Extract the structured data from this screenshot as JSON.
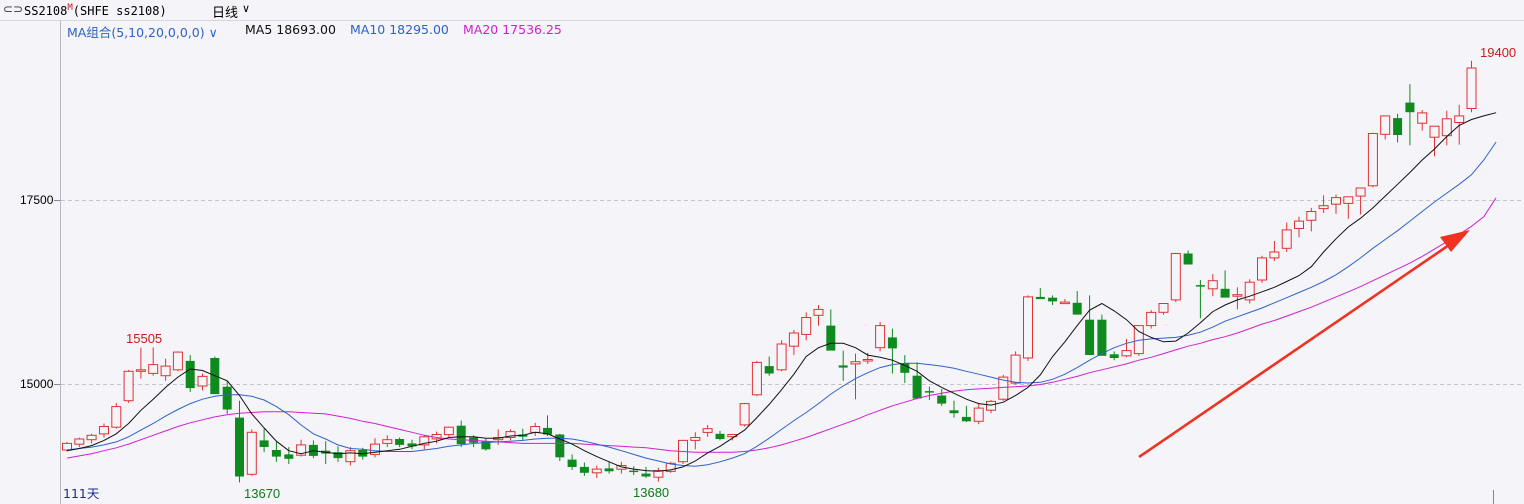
{
  "header": {
    "symbol_icon": "symbol-switch-icon",
    "symbol_code": "SS2108",
    "symbol_sup": "M",
    "exchange": "(SHFE ss2108)",
    "period": "日线",
    "period_chevron": "chevron-down-icon"
  },
  "indicator": {
    "name": "MA组合(5,10,20,0,0,0)",
    "ma5_label": "MA5 18693.00",
    "ma10_label": "MA10 18295.00",
    "ma20_label": "MA20 17536.25",
    "colors": {
      "ma5": "#111111",
      "ma10": "#2e62c9",
      "ma20": "#d020d0",
      "up": "#e03232",
      "down": "#0f8a1f",
      "arrow": "#ee3322"
    }
  },
  "footer": {
    "day_count": "111天"
  },
  "chart_data": {
    "type": "candlestick",
    "title": "",
    "y_ticks": [
      15000,
      17500
    ],
    "ylim": [
      13550,
      19700
    ],
    "grid": "dashed horizontal at y ticks",
    "annotations": {
      "high_1": "15505",
      "low_1": "13670",
      "low_2": "13680",
      "high_2": "19400"
    },
    "trend_arrow": "red arrow pointing up-right",
    "ohlc": [
      [
        14110,
        14220,
        14090,
        14200
      ],
      [
        14190,
        14280,
        14150,
        14260
      ],
      [
        14250,
        14330,
        14200,
        14310
      ],
      [
        14330,
        14470,
        14280,
        14430
      ],
      [
        14420,
        14750,
        14400,
        14700
      ],
      [
        14780,
        15200,
        14750,
        15180
      ],
      [
        15200,
        15500,
        15080,
        15200
      ],
      [
        15150,
        15505,
        15120,
        15270
      ],
      [
        15120,
        15350,
        15050,
        15250
      ],
      [
        15200,
        15450,
        15180,
        15440
      ],
      [
        15320,
        15400,
        14900,
        14950
      ],
      [
        14980,
        15150,
        14920,
        15110
      ],
      [
        15360,
        15380,
        14880,
        14870
      ],
      [
        14970,
        15050,
        14600,
        14660
      ],
      [
        14550,
        14780,
        13670,
        13750
      ],
      [
        13780,
        14390,
        13760,
        14350
      ],
      [
        14240,
        14400,
        14080,
        14150
      ],
      [
        14110,
        14220,
        13950,
        14020
      ],
      [
        14050,
        14150,
        13920,
        13990
      ],
      [
        14040,
        14250,
        14020,
        14180
      ],
      [
        14180,
        14240,
        14000,
        14030
      ],
      [
        14100,
        14230,
        13920,
        14060
      ],
      [
        14080,
        14160,
        13950,
        14000
      ],
      [
        13950,
        14150,
        13900,
        14100
      ],
      [
        14110,
        14140,
        13980,
        14020
      ],
      [
        14050,
        14270,
        14010,
        14190
      ],
      [
        14200,
        14310,
        14150,
        14250
      ],
      [
        14260,
        14280,
        14150,
        14180
      ],
      [
        14200,
        14250,
        14120,
        14160
      ],
      [
        14180,
        14310,
        14120,
        14290
      ],
      [
        14260,
        14360,
        14200,
        14320
      ],
      [
        14320,
        14430,
        14290,
        14420
      ],
      [
        14440,
        14510,
        14150,
        14190
      ],
      [
        14280,
        14310,
        14150,
        14210
      ],
      [
        14230,
        14260,
        14100,
        14120
      ],
      [
        14250,
        14390,
        14180,
        14280
      ],
      [
        14280,
        14390,
        14240,
        14360
      ],
      [
        14320,
        14400,
        14240,
        14290
      ],
      [
        14350,
        14480,
        14300,
        14430
      ],
      [
        14410,
        14580,
        14300,
        14320
      ],
      [
        14320,
        14330,
        13960,
        14010
      ],
      [
        13980,
        14050,
        13840,
        13880
      ],
      [
        13880,
        13940,
        13760,
        13800
      ],
      [
        13800,
        13900,
        13730,
        13850
      ],
      [
        13860,
        13950,
        13790,
        13820
      ],
      [
        13850,
        13950,
        13790,
        13900
      ],
      [
        13830,
        13890,
        13770,
        13810
      ],
      [
        13790,
        13880,
        13730,
        13750
      ],
      [
        13740,
        13870,
        13680,
        13830
      ],
      [
        13820,
        13950,
        13800,
        13930
      ],
      [
        13950,
        14250,
        13920,
        14240
      ],
      [
        14240,
        14350,
        14120,
        14280
      ],
      [
        14350,
        14450,
        14290,
        14400
      ],
      [
        14330,
        14370,
        14240,
        14260
      ],
      [
        14290,
        14330,
        14240,
        14320
      ],
      [
        14450,
        14750,
        14430,
        14740
      ],
      [
        14860,
        15320,
        14840,
        15300
      ],
      [
        15250,
        15380,
        15120,
        15150
      ],
      [
        15200,
        15600,
        15180,
        15550
      ],
      [
        15520,
        15740,
        15400,
        15700
      ],
      [
        15680,
        15980,
        15600,
        15910
      ],
      [
        15940,
        16080,
        15800,
        16020
      ],
      [
        15800,
        16020,
        15500,
        15460
      ],
      [
        15260,
        15460,
        15050,
        15230
      ],
      [
        15280,
        15420,
        14800,
        15310
      ],
      [
        15320,
        15430,
        15280,
        15340
      ],
      [
        15500,
        15850,
        15450,
        15800
      ],
      [
        15640,
        15760,
        15150,
        15490
      ],
      [
        15290,
        15400,
        15020,
        15160
      ],
      [
        15120,
        15300,
        14800,
        14810
      ],
      [
        14910,
        14970,
        14790,
        14890
      ],
      [
        14850,
        14940,
        14710,
        14740
      ],
      [
        14650,
        14780,
        14550,
        14610
      ],
      [
        14560,
        14710,
        14490,
        14500
      ],
      [
        14500,
        14750,
        14460,
        14680
      ],
      [
        14650,
        14790,
        14610,
        14770
      ],
      [
        14800,
        15130,
        14780,
        15100
      ],
      [
        15020,
        15450,
        15000,
        15400
      ],
      [
        15360,
        16210,
        15320,
        16190
      ],
      [
        16190,
        16310,
        16170,
        16160
      ],
      [
        16180,
        16210,
        16080,
        16130
      ],
      [
        16110,
        16160,
        16100,
        16120
      ],
      [
        16110,
        16270,
        15950,
        15950
      ],
      [
        15880,
        16210,
        15420,
        15400
      ],
      [
        15880,
        15950,
        15550,
        15390
      ],
      [
        15410,
        15450,
        15330,
        15360
      ],
      [
        15390,
        15620,
        15370,
        15460
      ],
      [
        15420,
        15700,
        15390,
        15800
      ],
      [
        15800,
        16010,
        15760,
        15980
      ],
      [
        15980,
        16040,
        15950,
        16100
      ],
      [
        16150,
        16790,
        16120,
        16780
      ],
      [
        16780,
        16820,
        16760,
        16630
      ],
      [
        16350,
        16420,
        15900,
        16330
      ],
      [
        16300,
        16500,
        16200,
        16410
      ],
      [
        16300,
        16550,
        16250,
        16180
      ],
      [
        16200,
        16320,
        16020,
        16220
      ],
      [
        16150,
        16430,
        16100,
        16390
      ],
      [
        16420,
        16750,
        16380,
        16720
      ],
      [
        16720,
        16950,
        16680,
        16800
      ],
      [
        16850,
        17200,
        16800,
        17100
      ],
      [
        17120,
        17280,
        17000,
        17220
      ],
      [
        17230,
        17400,
        17080,
        17350
      ],
      [
        17390,
        17570,
        17330,
        17430
      ],
      [
        17450,
        17580,
        17320,
        17540
      ],
      [
        17460,
        17480,
        17250,
        17550
      ],
      [
        17560,
        17600,
        17310,
        17670
      ],
      [
        17700,
        18420,
        17680,
        18410
      ],
      [
        18400,
        18650,
        18330,
        18650
      ],
      [
        18620,
        18680,
        18290,
        18390
      ],
      [
        18830,
        19080,
        18250,
        18700
      ],
      [
        18550,
        18730,
        18450,
        18690
      ],
      [
        18360,
        18480,
        18100,
        18510
      ],
      [
        18380,
        18720,
        18250,
        18610
      ],
      [
        18560,
        18800,
        18260,
        18650
      ],
      [
        18750,
        19400,
        18700,
        19300
      ]
    ],
    "ma5": [
      14100,
      14130,
      14170,
      14240,
      14330,
      14470,
      14650,
      14800,
      14960,
      15100,
      15210,
      15190,
      15120,
      15050,
      14850,
      14600,
      14410,
      14230,
      14100,
      14060,
      14100,
      14080,
      14060,
      14070,
      14060,
      14080,
      14100,
      14120,
      14160,
      14200,
      14230,
      14280,
      14290,
      14290,
      14270,
      14270,
      14300,
      14310,
      14350,
      14330,
      14260,
      14190,
      14100,
      14020,
      13950,
      13880,
      13850,
      13830,
      13820,
      13840,
      13880,
      13960,
      14070,
      14160,
      14270,
      14380,
      14550,
      14730,
      14930,
      15140,
      15380,
      15500,
      15560,
      15560,
      15500,
      15400,
      15370,
      15330,
      15260,
      15180,
      15050,
      14960,
      14880,
      14800,
      14740,
      14720,
      14760,
      14850,
      14960,
      15130,
      15380,
      15580,
      15800,
      16010,
      16100,
      16000,
      15880,
      15720,
      15640,
      15580,
      15590,
      15700,
      15840,
      15990,
      16080,
      16150,
      16200,
      16260,
      16320,
      16400,
      16480,
      16600,
      16800,
      16980,
      17140,
      17260,
      17400,
      17560,
      17720,
      17880,
      18050,
      18200,
      18370,
      18520,
      18600,
      18650,
      18693
    ],
    "ma10": [
      14110,
      14130,
      14150,
      14180,
      14220,
      14290,
      14380,
      14470,
      14570,
      14660,
      14740,
      14800,
      14840,
      14860,
      14860,
      14840,
      14790,
      14700,
      14590,
      14450,
      14330,
      14260,
      14180,
      14130,
      14120,
      14100,
      14090,
      14090,
      14090,
      14110,
      14130,
      14160,
      14180,
      14200,
      14210,
      14220,
      14230,
      14240,
      14260,
      14270,
      14270,
      14260,
      14230,
      14190,
      14150,
      14100,
      14050,
      14000,
      13960,
      13920,
      13900,
      13890,
      13910,
      13950,
      14000,
      14060,
      14160,
      14270,
      14390,
      14510,
      14620,
      14740,
      14870,
      14980,
      15080,
      15160,
      15230,
      15270,
      15290,
      15290,
      15270,
      15250,
      15220,
      15180,
      15140,
      15100,
      15060,
      15030,
      15020,
      15030,
      15070,
      15140,
      15230,
      15330,
      15420,
      15500,
      15560,
      15600,
      15620,
      15630,
      15640,
      15670,
      15710,
      15780,
      15860,
      15920,
      15980,
      16040,
      16110,
      16180,
      16250,
      16320,
      16400,
      16490,
      16600,
      16720,
      16850,
      16970,
      17090,
      17220,
      17350,
      17480,
      17600,
      17720,
      17850,
      18050,
      18295
    ],
    "ma20": [
      14000,
      14030,
      14060,
      14100,
      14140,
      14190,
      14250,
      14310,
      14370,
      14430,
      14480,
      14520,
      14560,
      14590,
      14610,
      14620,
      14630,
      14630,
      14630,
      14620,
      14610,
      14600,
      14570,
      14540,
      14500,
      14470,
      14430,
      14390,
      14350,
      14310,
      14280,
      14260,
      14250,
      14240,
      14230,
      14220,
      14210,
      14200,
      14200,
      14200,
      14200,
      14200,
      14190,
      14180,
      14170,
      14160,
      14150,
      14140,
      14120,
      14100,
      14090,
      14080,
      14080,
      14080,
      14080,
      14090,
      14110,
      14140,
      14180,
      14230,
      14280,
      14340,
      14400,
      14460,
      14520,
      14590,
      14650,
      14710,
      14760,
      14810,
      14850,
      14880,
      14910,
      14930,
      14940,
      14950,
      14960,
      14970,
      14980,
      15000,
      15030,
      15070,
      15110,
      15160,
      15200,
      15240,
      15280,
      15330,
      15370,
      15420,
      15470,
      15520,
      15560,
      15610,
      15650,
      15700,
      15760,
      15820,
      15870,
      15930,
      15990,
      16050,
      16120,
      16190,
      16260,
      16330,
      16410,
      16490,
      16570,
      16650,
      16740,
      16840,
      16940,
      17040,
      17150,
      17280,
      17536.25
    ]
  }
}
